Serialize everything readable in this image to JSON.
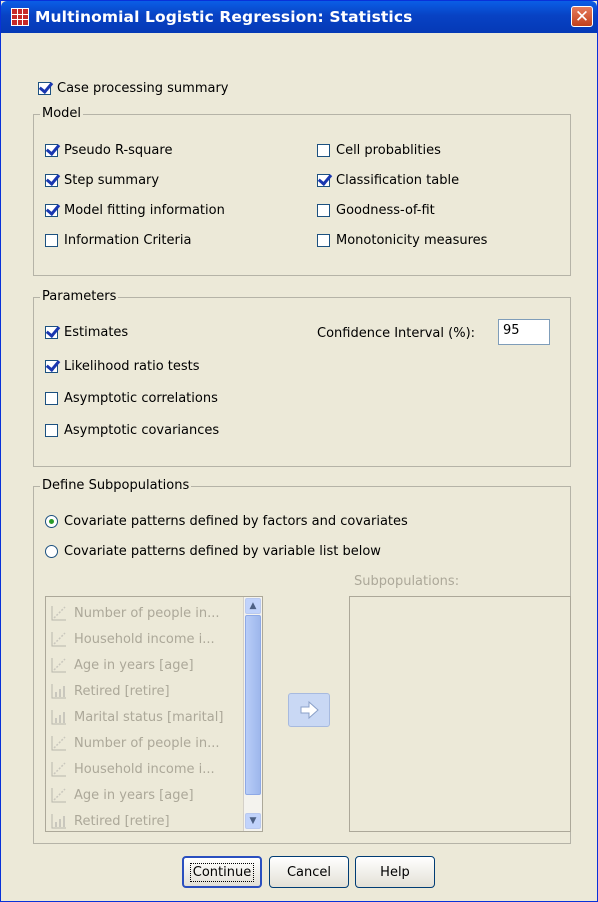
{
  "window": {
    "title": "Multinomial Logistic Regression: Statistics",
    "close_label": "✕"
  },
  "case_processing": {
    "label": "Case processing summary",
    "checked": true
  },
  "model": {
    "legend": "Model",
    "left": [
      {
        "label": "Pseudo R-square",
        "checked": true
      },
      {
        "label": "Step summary",
        "checked": true
      },
      {
        "label": "Model fitting information",
        "checked": true
      },
      {
        "label": "Information Criteria",
        "checked": false
      }
    ],
    "right": [
      {
        "label": "Cell probablities",
        "checked": false
      },
      {
        "label": "Classification table",
        "checked": true
      },
      {
        "label": "Goodness-of-fit",
        "checked": false
      },
      {
        "label": "Monotonicity measures",
        "checked": false
      }
    ]
  },
  "parameters": {
    "legend": "Parameters",
    "items": [
      {
        "label": "Estimates",
        "checked": true
      },
      {
        "label": "Likelihood ratio tests",
        "checked": true
      },
      {
        "label": "Asymptotic correlations",
        "checked": false
      },
      {
        "label": "Asymptotic covariances",
        "checked": false
      }
    ],
    "ci_label": "Confidence Interval (%):",
    "ci_value": "95"
  },
  "subpopulations": {
    "legend": "Define Subpopulations",
    "radios": [
      {
        "label": "Covariate patterns defined by factors and covariates",
        "selected": true
      },
      {
        "label": "Covariate patterns defined by variable list below",
        "selected": false
      }
    ],
    "target_label": "Subpopulations:",
    "variables": [
      {
        "label": "Number of people in...",
        "icon": "scale-icon"
      },
      {
        "label": "Household income i...",
        "icon": "scale-icon"
      },
      {
        "label": "Age in years [age]",
        "icon": "scale-icon"
      },
      {
        "label": "Retired [retire]",
        "icon": "ordinal-icon"
      },
      {
        "label": "Marital status [marital]",
        "icon": "ordinal-icon"
      },
      {
        "label": "Number of people in...",
        "icon": "scale-icon"
      },
      {
        "label": "Household income i...",
        "icon": "scale-icon"
      },
      {
        "label": "Age in years [age]",
        "icon": "scale-icon"
      },
      {
        "label": "Retired [retire]",
        "icon": "ordinal-icon"
      }
    ]
  },
  "buttons": {
    "continue": "Continue",
    "cancel": "Cancel",
    "help": "Help"
  },
  "colors": {
    "titlebar": "#0842c4",
    "dialog_bg": "#ece9d8",
    "checkmark": "#1a37b0"
  }
}
